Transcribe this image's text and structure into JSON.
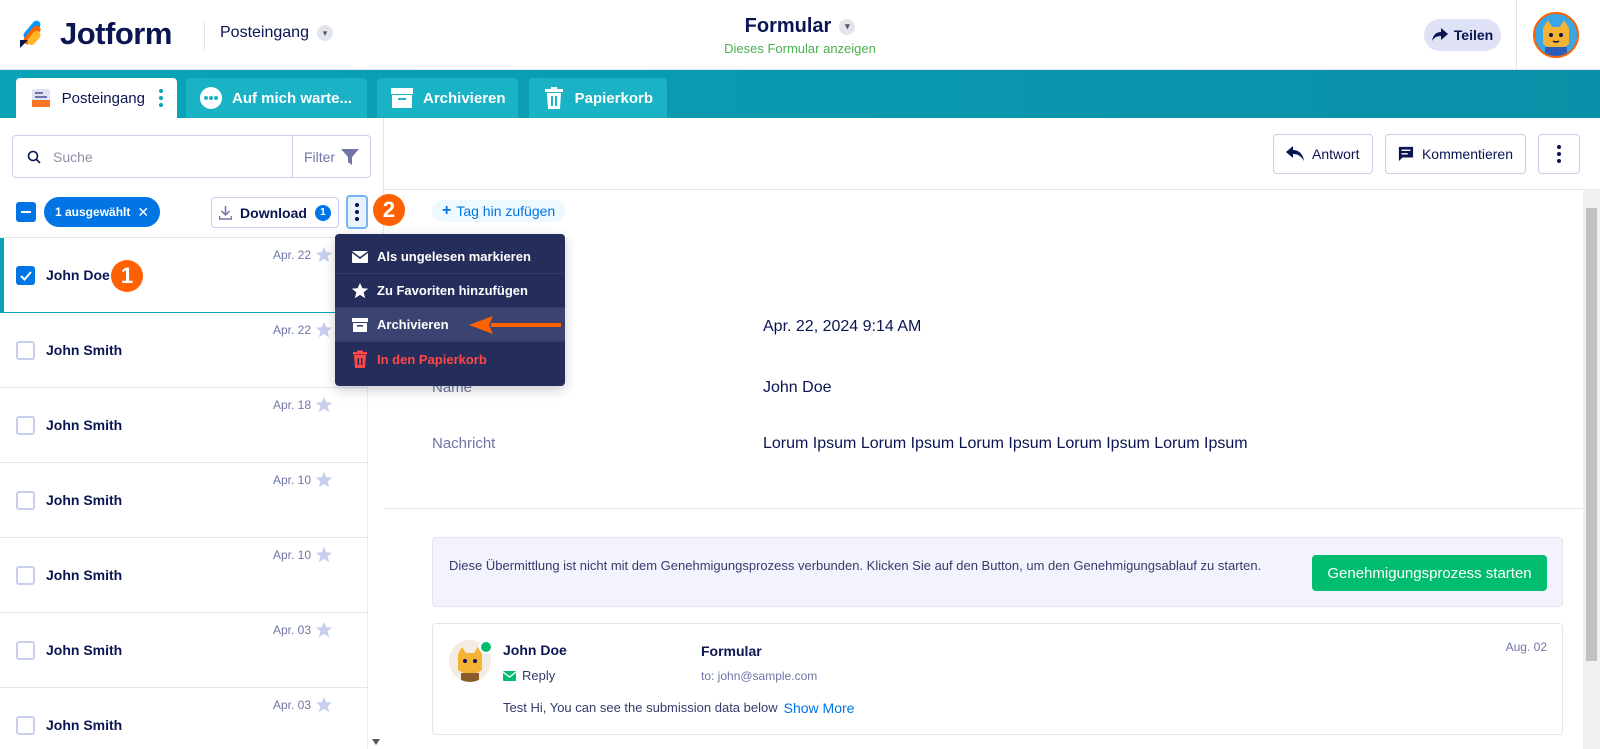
{
  "header": {
    "logo_text": "Jotform",
    "inbox_dropdown": "Posteingang",
    "form_title": "Formular",
    "form_subtitle": "Dieses Formular anzeigen",
    "share_label": "Teilen"
  },
  "tabs": [
    {
      "label": "Posteingang",
      "icon": "inbox-icon"
    },
    {
      "label": "Auf mich warte...",
      "icon": "waiting-icon"
    },
    {
      "label": "Archivieren",
      "icon": "archive-icon"
    },
    {
      "label": "Papierkorb",
      "icon": "trash-icon"
    }
  ],
  "left": {
    "search_placeholder": "Suche",
    "filter_label": "Filter",
    "selected_label": "1 ausgewählt",
    "download_label": "Download",
    "download_count": "1"
  },
  "submissions": [
    {
      "name": "John Doe",
      "date": "Apr. 22",
      "selected": true
    },
    {
      "name": "John Smith",
      "date": "Apr. 22",
      "selected": false
    },
    {
      "name": "John Smith",
      "date": "Apr. 18",
      "selected": false
    },
    {
      "name": "John Smith",
      "date": "Apr. 10",
      "selected": false
    },
    {
      "name": "John Smith",
      "date": "Apr. 10",
      "selected": false
    },
    {
      "name": "John Smith",
      "date": "Apr. 03",
      "selected": false
    },
    {
      "name": "John Smith",
      "date": "Apr. 03",
      "selected": false
    }
  ],
  "annotations": {
    "step1": "1",
    "step2": "2"
  },
  "menu": {
    "items": [
      {
        "label": "Als ungelesen markieren",
        "icon": "envelope-icon"
      },
      {
        "label": "Zu Favoriten hinzufügen",
        "icon": "star-icon"
      },
      {
        "label": "Archivieren",
        "icon": "archive-icon"
      },
      {
        "label": "In den Papierkorb",
        "icon": "trash-icon"
      }
    ]
  },
  "toolbar": {
    "reply_label": "Antwort",
    "comment_label": "Kommentieren"
  },
  "detail": {
    "add_tag": "Tag hin zufügen",
    "date_value": "Apr. 22, 2024 9:14 AM",
    "name_label": "Name",
    "name_value": "John Doe",
    "message_label": "Nachricht",
    "message_value": "Lorum Ipsum Lorum Ipsum Lorum Ipsum Lorum Ipsum Lorum Ipsum"
  },
  "approval": {
    "text": "Diese Übermittlung ist nicht mit dem Genehmigungsprozess verbunden. Klicken Sie auf den Button, um den Genehmigungsablauf zu starten.",
    "button_label": "Genehmigungsprozess starten"
  },
  "email": {
    "sender": "John Doe",
    "reply_label": "Reply",
    "form_name": "Formular",
    "to": "to: john@sample.com",
    "date": "Aug. 02",
    "body": "Test Hi, You can see the submission data below",
    "show_more": "Show More"
  },
  "colors": {
    "brand_navy": "#0a1551",
    "teal_bar": "#0aa4b8",
    "primary_blue": "#0075e3",
    "annotation_orange": "#ff6100",
    "approve_green": "#01bd6f",
    "menu_bg": "#252d5b",
    "danger_red": "#ff4948"
  }
}
